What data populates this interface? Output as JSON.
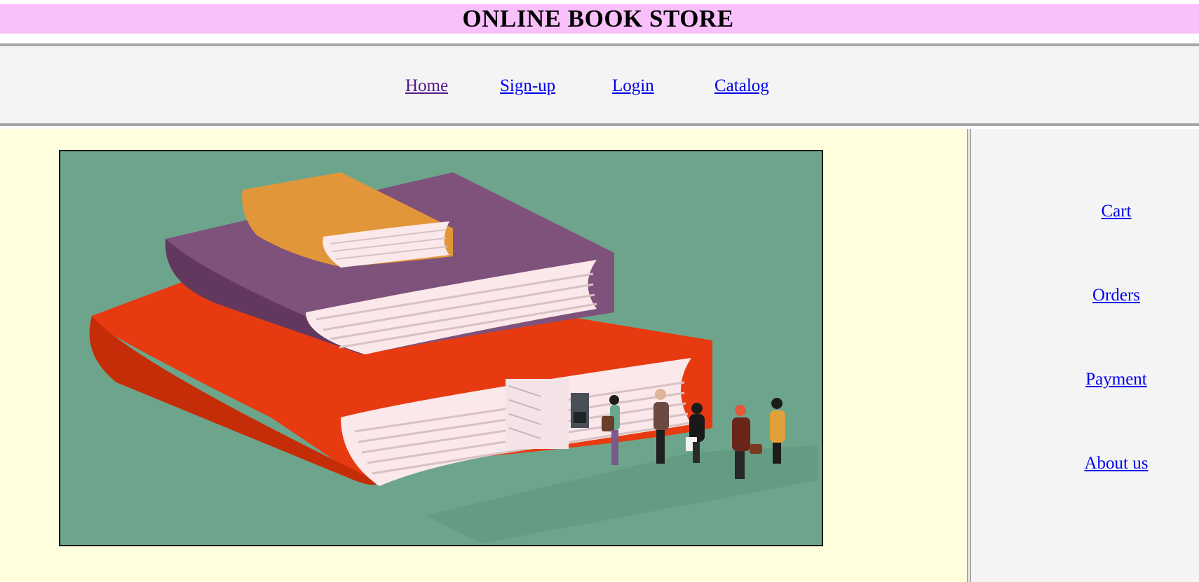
{
  "header": {
    "title": "ONLINE BOOK STORE"
  },
  "nav": {
    "items": [
      {
        "label": "Home",
        "visited": true
      },
      {
        "label": "Sign-up",
        "visited": false
      },
      {
        "label": "Login",
        "visited": false
      },
      {
        "label": "Catalog",
        "visited": false
      }
    ]
  },
  "sidebar": {
    "items": [
      {
        "label": "Cart"
      },
      {
        "label": "Orders"
      },
      {
        "label": "Payment"
      },
      {
        "label": "About us"
      }
    ]
  },
  "main": {
    "image": {
      "semantic": "stacked-books-bookstore-illustration"
    }
  },
  "colors": {
    "title_bar": "#fac0fc",
    "main_bg": "#ffffdd",
    "frame_bg": "#f4f4f4",
    "link": "#0000ee",
    "link_visited": "#551a8b",
    "illustration_bg": "#6da58c"
  }
}
